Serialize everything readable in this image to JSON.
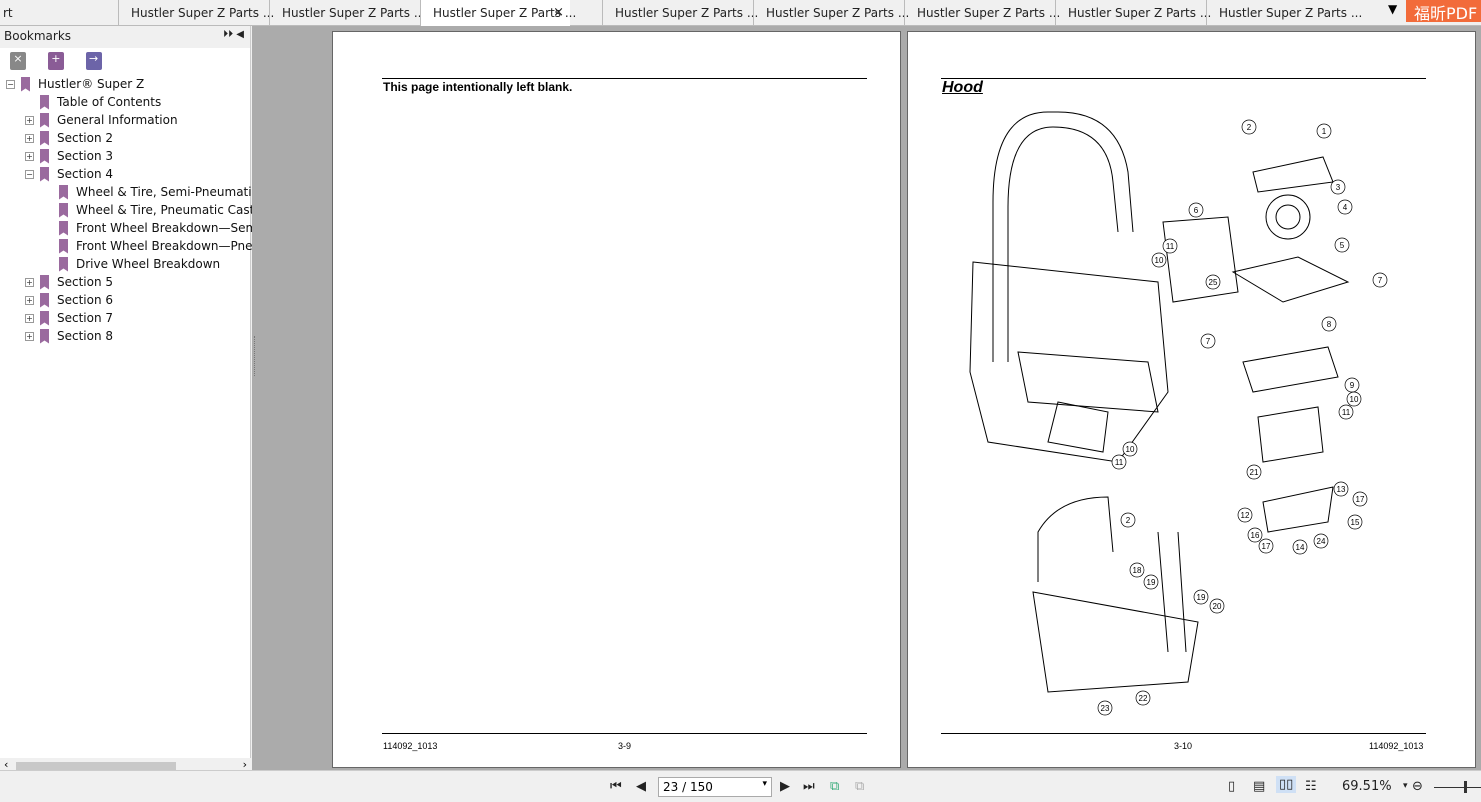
{
  "tabs": [
    {
      "label": "rt"
    },
    {
      "label": "Hustler Super Z Parts ..."
    },
    {
      "label": "Hustler Super Z Parts ..."
    },
    {
      "label": "Hustler Super Z Parts ...",
      "active": true
    },
    {
      "label": "Hustler Super Z Parts ..."
    },
    {
      "label": "Hustler Super Z Parts ..."
    },
    {
      "label": "Hustler Super Z Parts ..."
    },
    {
      "label": "Hustler Super Z Parts ..."
    },
    {
      "label": "Hustler Super Z Parts ..."
    }
  ],
  "tab_close": "×",
  "tab_menu": "▼",
  "brand": "福昕PDF",
  "sidebar": {
    "title": "Bookmarks",
    "controls": "⏵⏵ ◀",
    "bookmarks": [
      {
        "label": "Hustler® Super Z",
        "level": 0,
        "toggle": "−"
      },
      {
        "label": "Table of Contents",
        "level": 1,
        "toggle": ""
      },
      {
        "label": "General Information",
        "level": 1,
        "toggle": "+"
      },
      {
        "label": "Section 2",
        "level": 1,
        "toggle": "+"
      },
      {
        "label": "Section 3",
        "level": 1,
        "toggle": "+"
      },
      {
        "label": "Section 4",
        "level": 1,
        "toggle": "−"
      },
      {
        "label": "Wheel & Tire, Semi-Pneumatic",
        "level": 2,
        "toggle": ""
      },
      {
        "label": "Wheel & Tire, Pneumatic Caste",
        "level": 2,
        "toggle": ""
      },
      {
        "label": "Front Wheel Breakdown—Sem",
        "level": 2,
        "toggle": ""
      },
      {
        "label": "Front Wheel Breakdown—Pneu",
        "level": 2,
        "toggle": ""
      },
      {
        "label": "Drive Wheel Breakdown",
        "level": 2,
        "toggle": ""
      },
      {
        "label": "Section 5",
        "level": 1,
        "toggle": "+"
      },
      {
        "label": "Section 6",
        "level": 1,
        "toggle": "+"
      },
      {
        "label": "Section 7",
        "level": 1,
        "toggle": "+"
      },
      {
        "label": "Section 8",
        "level": 1,
        "toggle": "+"
      }
    ]
  },
  "left_page": {
    "heading": "This page intentionally left blank.",
    "footer_left": "114092_1013",
    "footer_center": "3-9"
  },
  "right_page": {
    "heading": "Hood",
    "footer_center": "3-10",
    "footer_right": "114092_1013",
    "callouts": [
      "2",
      "1",
      "3",
      "4",
      "6",
      "5",
      "11",
      "10",
      "7",
      "25",
      "8",
      "7",
      "9",
      "10",
      "11",
      "10",
      "11",
      "21",
      "13",
      "17",
      "12",
      "15",
      "16",
      "17",
      "14",
      "24",
      "2",
      "18",
      "19",
      "19",
      "20",
      "22",
      "23"
    ]
  },
  "statusbar": {
    "page_value": "23 / 150",
    "zoom": "69.51%"
  }
}
